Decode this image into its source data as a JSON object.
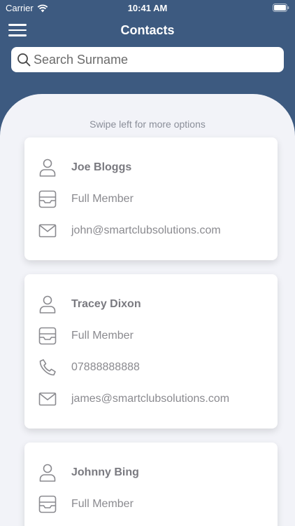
{
  "status_bar": {
    "carrier": "Carrier",
    "time": "10:41 AM"
  },
  "nav": {
    "title": "Contacts"
  },
  "search": {
    "placeholder": "Search Surname",
    "value": ""
  },
  "hint": "Swipe left for more options",
  "contacts": [
    {
      "name": "Joe Bloggs",
      "membership": "Full Member",
      "email": "john@smartclubsolutions.com"
    },
    {
      "name": "Tracey Dixon",
      "membership": "Full Member",
      "phone": "07888888888",
      "email": "james@smartclubsolutions.com"
    },
    {
      "name": "Johnny Bing",
      "membership": "Full Member"
    }
  ],
  "colors": {
    "header": "#3d5a80",
    "background": "#f2f3f8",
    "card": "#ffffff",
    "text_muted": "#8a8a8f"
  }
}
